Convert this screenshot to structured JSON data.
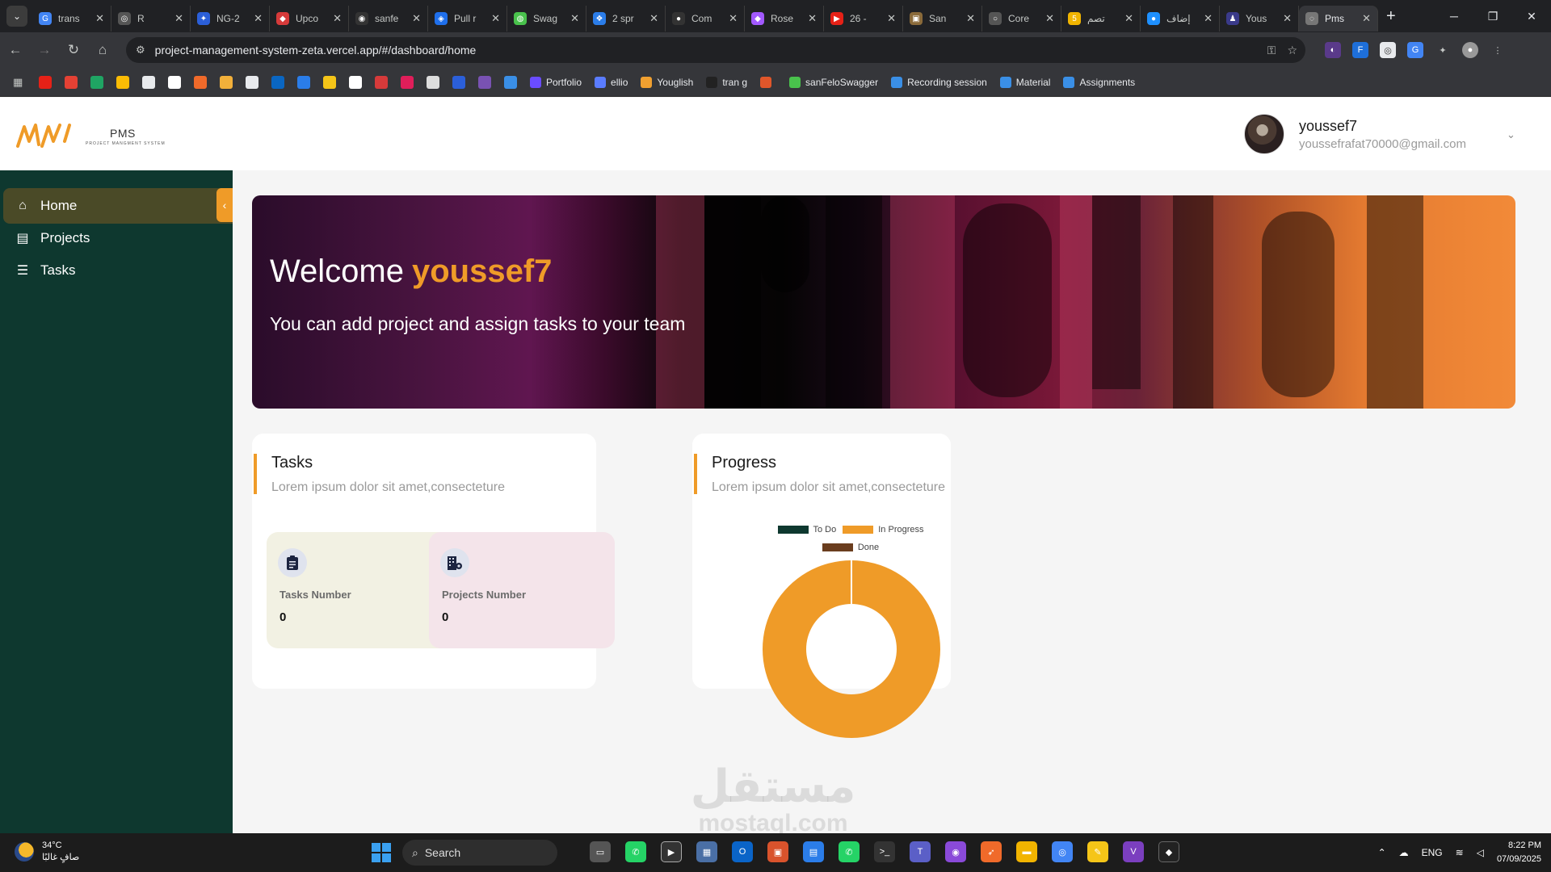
{
  "browser": {
    "tabs": [
      {
        "label": "trans",
        "color": "#4285f4",
        "glyph": "G"
      },
      {
        "label": "R",
        "color": "#555",
        "glyph": "◎"
      },
      {
        "label": "NG-2",
        "color": "#2b5fd9",
        "glyph": "✦"
      },
      {
        "label": "Upco",
        "color": "#d63a3a",
        "glyph": "◆"
      },
      {
        "label": "sanfe",
        "color": "#333",
        "glyph": "◉"
      },
      {
        "label": "Pull r",
        "color": "#1f6feb",
        "glyph": "◈"
      },
      {
        "label": "Swag",
        "color": "#49c24c",
        "glyph": "◍"
      },
      {
        "label": "2 spr",
        "color": "#2b7de9",
        "glyph": "❖"
      },
      {
        "label": "Com",
        "color": "#333",
        "glyph": "●"
      },
      {
        "label": "Rose",
        "color": "#a259ff",
        "glyph": "◆"
      },
      {
        "label": "26 -",
        "color": "#e62117",
        "glyph": "▶"
      },
      {
        "label": "San",
        "color": "#8a6a3a",
        "glyph": "▣"
      },
      {
        "label": "Core",
        "color": "#555",
        "glyph": "○"
      },
      {
        "label": "تصم",
        "color": "#f0b400",
        "glyph": "5"
      },
      {
        "label": "إضاف",
        "color": "#1e90ff",
        "glyph": "●"
      },
      {
        "label": "Yous",
        "color": "#3a3a8a",
        "glyph": "♟"
      },
      {
        "label": "Pms",
        "color": "#777",
        "glyph": "◌",
        "active": true
      }
    ],
    "new_tab": "+",
    "url": "project-management-system-zeta.vercel.app/#/dashboard/home",
    "bookmarks": [
      {
        "label": "Portfolio",
        "color": "#6a4cff"
      },
      {
        "label": "ellio",
        "color": "#5a7cff"
      },
      {
        "label": "Youglish",
        "color": "#f0a030"
      },
      {
        "label": "tran g",
        "color": "#222"
      },
      {
        "label": "",
        "color": "#e0562a"
      },
      {
        "label": "sanFeloSwagger",
        "color": "#49c24c"
      },
      {
        "label": "Recording session",
        "color": "#3a8fe6"
      },
      {
        "label": "Material",
        "color": "#3a8fe6"
      },
      {
        "label": "Assignments",
        "color": "#3a8fe6"
      }
    ]
  },
  "app": {
    "logo_text": "PMS",
    "logo_subtext": "PROJECT MANGMENT SYSTEM",
    "user": {
      "name": "youssef7",
      "email": "youssefrafat70000@gmail.com"
    },
    "sidebar": {
      "items": [
        {
          "label": "Home",
          "icon": "home-icon",
          "active": true
        },
        {
          "label": "Projects",
          "icon": "projects-icon"
        },
        {
          "label": "Tasks",
          "icon": "tasks-icon"
        }
      ]
    },
    "banner": {
      "welcome": "Welcome",
      "username": "youssef7",
      "subtitle": "You can add project and assign tasks to your team"
    },
    "tasks_card": {
      "title": "Tasks",
      "subtitle": "Lorem ipsum dolor sit amet,consecteture",
      "stats": [
        {
          "label": "Tasks Number",
          "value": "0",
          "bg": "#f2f1e3",
          "icon_bg": "#dfe3ee"
        },
        {
          "label": "Projects Number",
          "value": "0",
          "bg": "#f4e4ea",
          "icon_bg": "#dfe3ee"
        }
      ]
    },
    "progress_card": {
      "title": "Progress",
      "subtitle": "Lorem ipsum dolor sit amet,consecteture"
    }
  },
  "chart_data": {
    "type": "pie",
    "variant": "doughnut",
    "legend_position": "top",
    "series": [
      {
        "name": "To Do",
        "value": 0,
        "color": "#0e382f"
      },
      {
        "name": "In Progress",
        "value": 1,
        "color": "#ef9b28"
      },
      {
        "name": "Done",
        "value": 0,
        "color": "#6a3d1e"
      }
    ]
  },
  "watermark": {
    "arabic": "مستقل",
    "latin": "mostaql.com"
  },
  "taskbar": {
    "weather_temp": "34°C",
    "weather_desc": "صافٍ غالبًا",
    "search": "Search",
    "lang": "ENG",
    "time": "8:22 PM",
    "date": "07/09/2025"
  }
}
